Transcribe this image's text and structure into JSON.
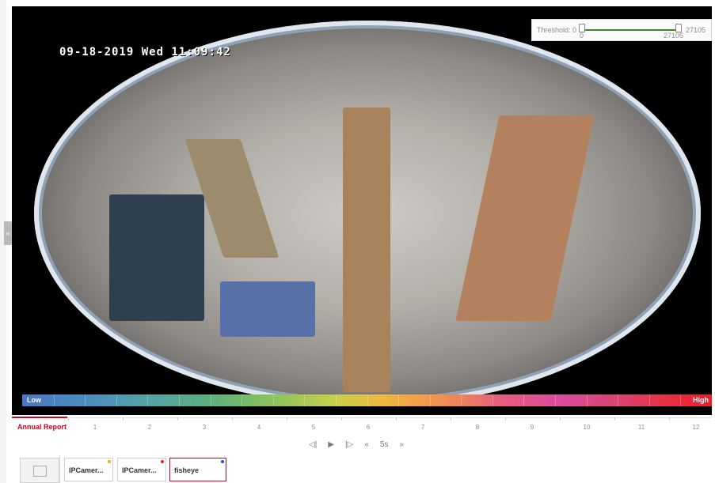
{
  "video": {
    "timestamp": "09-18-2019 Wed 11:09:42"
  },
  "threshold": {
    "label": "Threshold: 0",
    "min": "0",
    "max": "27105",
    "max_right": "27105",
    "min_value": 0,
    "max_value": 27105
  },
  "heatmap_legend": {
    "low": "Low",
    "high": "High"
  },
  "report": {
    "title": "Annual Report",
    "months": [
      "1",
      "2",
      "3",
      "4",
      "5",
      "6",
      "7",
      "8",
      "9",
      "10",
      "11",
      "12"
    ]
  },
  "playback": {
    "speed": "5s",
    "icons": [
      "step-back-icon",
      "play-icon",
      "step-forward-icon",
      "rewind-icon",
      "fast-forward-icon"
    ]
  },
  "cameras": [
    {
      "label": "IPCamer...",
      "dot_color": "#f5a623"
    },
    {
      "label": "IPCamer...",
      "dot_color": "#e02020"
    },
    {
      "label": "fisheye",
      "dot_color": "#1f4fd8",
      "selected": true
    }
  ],
  "colors": {
    "accent": "#d0021b",
    "track": "#3a8c26"
  }
}
